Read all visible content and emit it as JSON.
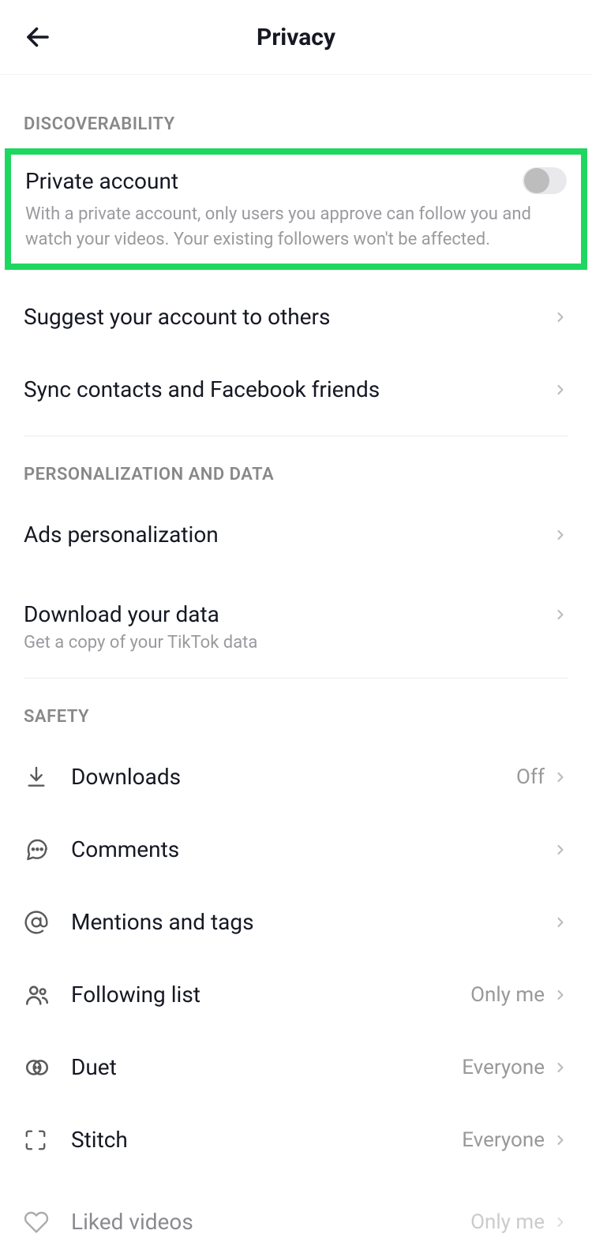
{
  "header": {
    "title": "Privacy"
  },
  "sections": {
    "discoverability": {
      "header": "DISCOVERABILITY",
      "private_account": {
        "label": "Private account",
        "description": "With a private account, only users you approve can follow you and watch your videos. Your existing followers won't be affected."
      },
      "suggest": {
        "label": "Suggest your account to others"
      },
      "sync": {
        "label": "Sync contacts and Facebook friends"
      }
    },
    "personalization": {
      "header": "PERSONALIZATION AND DATA",
      "ads": {
        "label": "Ads personalization"
      },
      "download": {
        "label": "Download your data",
        "description": "Get a copy of your TikTok data"
      }
    },
    "safety": {
      "header": "SAFETY",
      "downloads": {
        "label": "Downloads",
        "value": "Off"
      },
      "comments": {
        "label": "Comments"
      },
      "mentions": {
        "label": "Mentions and tags"
      },
      "following": {
        "label": "Following list",
        "value": "Only me"
      },
      "duet": {
        "label": "Duet",
        "value": "Everyone"
      },
      "stitch": {
        "label": "Stitch",
        "value": "Everyone"
      },
      "liked": {
        "label": "Liked videos",
        "value": "Only me"
      }
    }
  }
}
